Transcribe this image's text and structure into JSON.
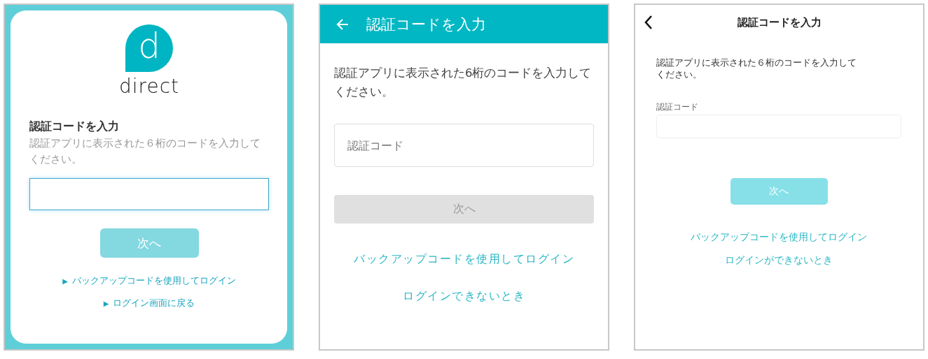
{
  "panels": [
    {
      "kind": "web",
      "logo": {
        "letter": "d",
        "wordmark": "direct"
      },
      "title": "認証コードを入力",
      "description": "認証アプリに表示された６桁のコードを入力してください。",
      "code_field": {
        "focused": true
      },
      "next_button": {
        "label": "次へ",
        "disabled": true
      },
      "links": [
        {
          "marker": "▶",
          "label": "バックアップコードを使用してログイン"
        },
        {
          "marker": "▶",
          "label": "ログイン画面に戻る"
        }
      ]
    },
    {
      "kind": "android",
      "title": "認証コードを入力",
      "description": "認証アプリに表示された6桁のコードを入力してください。",
      "code_field": {
        "placeholder": "認証コード",
        "focused": false
      },
      "next_button": {
        "label": "次へ",
        "disabled": true
      },
      "links": [
        {
          "label": "バックアップコードを使用してログイン"
        },
        {
          "label": "ログインできないとき"
        }
      ]
    },
    {
      "kind": "ios",
      "title": "認証コードを入力",
      "description": "認証アプリに表示された６桁のコードを入力してください。",
      "code_field": {
        "label": "認証コード",
        "focused": false
      },
      "next_button": {
        "label": "次へ",
        "disabled": true
      },
      "links": [
        {
          "label": "バックアップコードを使用してログイン"
        },
        {
          "label": "ログインができないとき"
        }
      ]
    }
  ]
}
